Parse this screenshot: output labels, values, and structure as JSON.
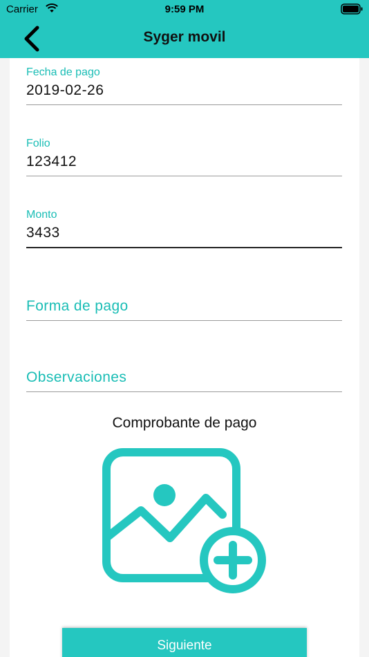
{
  "status_bar": {
    "carrier": "Carrier",
    "time": "9:59 PM",
    "wifi_icon": "wifi-icon",
    "battery_icon": "battery-icon"
  },
  "nav": {
    "title": "Syger movil",
    "back_icon": "chevron-left-icon"
  },
  "form": {
    "payment_date": {
      "label": "Fecha de pago",
      "value": "2019-02-26"
    },
    "folio": {
      "label": "Folio",
      "value": "123412"
    },
    "amount": {
      "label": "Monto",
      "value": "3433"
    },
    "payment_method": {
      "placeholder": "Forma de pago"
    },
    "observations": {
      "placeholder": "Observaciones"
    }
  },
  "receipt": {
    "title": "Comprobante de pago",
    "icon": "add-image-icon"
  },
  "actions": {
    "next_label": "Siguiente"
  },
  "colors": {
    "accent": "#25c7c0",
    "label": "#19bdb5"
  }
}
